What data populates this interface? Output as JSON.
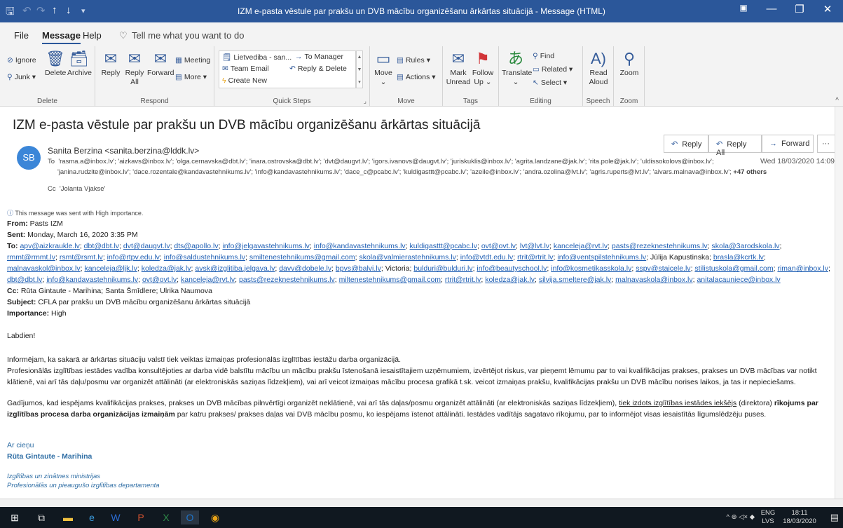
{
  "window": {
    "title": "IZM e-pasta vēstule par prakšu un DVB mācību organizēšanu ārkārtas situācijā  -  Message (HTML)"
  },
  "menu": {
    "file": "File",
    "message": "Message",
    "help": "Help",
    "tell_me": "Tell me what you want to do"
  },
  "ribbon": {
    "delete_group": {
      "label": "Delete",
      "ignore": "Ignore",
      "junk": "Junk",
      "delete": "Delete",
      "archive": "Archive"
    },
    "respond_group": {
      "label": "Respond",
      "reply": "Reply",
      "reply_all_1": "Reply",
      "reply_all_2": "All",
      "forward": "Forward",
      "meeting": "Meeting",
      "more": "More"
    },
    "quick_steps_group": {
      "label": "Quick Steps",
      "item1": "Lietvediba - san...",
      "item2": "To Manager",
      "item3": "Team Email",
      "item4": "Reply & Delete",
      "item5": "Create New"
    },
    "move_group": {
      "label": "Move",
      "move": "Move",
      "rules": "Rules",
      "actions": "Actions"
    },
    "tags_group": {
      "label": "Tags",
      "mark_unread_1": "Mark",
      "mark_unread_2": "Unread",
      "follow_up_1": "Follow",
      "follow_up_2": "Up"
    },
    "editing_group": {
      "label": "Editing",
      "translate": "Translate",
      "find": "Find",
      "related": "Related",
      "select": "Select"
    },
    "speech_group": {
      "label": "Speech",
      "read_aloud_1": "Read",
      "read_aloud_2": "Aloud"
    },
    "zoom_group": {
      "label": "Zoom",
      "zoom": "Zoom"
    }
  },
  "message": {
    "subject": "IZM e-pasta vēstule par prakšu un DVB mācību organizēšanu ārkārtas situācijā",
    "avatar_initials": "SB",
    "sender": "Sanita Berzina <sanita.berzina@lddk.lv>",
    "to_label": "To",
    "to_line1": "'rasma.a@inbox.lv'; 'aizkavs@inbox.lv'; 'olga.cernavska@dbt.lv'; 'inara.ostrovska@dbt.lv'; 'dvt@daugvt.lv'; 'igors.ivanovs@daugvt.lv'; 'juriskuklis@inbox.lv'; 'agrita.landzane@jak.lv'; 'rita.pole@jak.lv'; 'uldissokolovs@inbox.lv';",
    "to_line2": "'janina.rudzite@inbox.lv'; 'dace.rozentale@kandavastehnikums.lv'; 'info@kandavastehnikums.lv'; 'dace_c@pcabc.lv'; 'kuldigasttt@pcabc.lv'; 'azeile@inbox.lv'; 'andra.ozolina@lvt.lv'; 'agris.ruperts@lvt.lv'; 'aivars.malnava@inbox.lv';",
    "to_more": "+47 others",
    "cc_label": "Cc",
    "cc_value": "'Jolanta Vjakse'",
    "date": "Wed 18/03/2020 14:09",
    "importance_note": "This message was sent with High importance.",
    "actions": {
      "reply": "Reply",
      "reply_all": "Reply All",
      "forward": "Forward",
      "more": "···"
    }
  },
  "body": {
    "from_label": "From:",
    "from_value": "Pasts IZM",
    "sent_label": "Sent:",
    "sent_value": "Monday, March 16, 2020 3:35 PM",
    "to_label": "To:",
    "to_emails": [
      "apv@aizkraukle.lv",
      "dbt@dbt.lv",
      "dvt@daugvt.lv",
      "dts@apollo.lv",
      "info@jelgavastehnikums.lv",
      "info@kandavastehnikums.lv",
      "kuldigasttt@pcabc.lv",
      "ovt@ovt.lv",
      "lvt@lvt.lv",
      "kanceleja@rvt.lv",
      "pasts@rezeknestehnikums.lv",
      "skola@3arodskola.lv",
      "rmmt@rmmt.lv",
      "rsmt@rsmt.lv",
      "info@rtpv.edu.lv",
      "info@saldustehnikums.lv",
      "smiltenestehnikums@gmail.com",
      "skola@valmierastehnikums.lv",
      "info@vtdt.edu.lv",
      "rtrit@rtrit.lv",
      "info@ventspilstehnikums.lv",
      "Jūlija Kapustinska",
      "brasla@kcrtk.lv",
      "malnavaskol@inbox.lv",
      "kanceleja@ljk.lv",
      "koledza@jak.lv",
      "avsk@izglitiba.jelgava.lv",
      "davv@dobele.lv",
      "bpvs@balvi.lv",
      "Victoria",
      "bulduri@bulduri.lv",
      "info@beautyschool.lv",
      "info@kosmetikasskola.lv",
      "sspv@staicele.lv",
      "stilistuskola@gmail.com",
      "riman@inbox.lv",
      "dbt@dbt.lv",
      "info@kandavastehnikums.lv",
      "ovt@ovt.lv",
      "kanceleja@rvt.lv",
      "pasts@rezeknestehnikums.lv",
      "miltenestehnikums@gmail.com",
      "rtrit@rtrit.lv",
      "koledza@jak.lv",
      "silvija.smeltere@jak.lv",
      "malnavaskola@inbox.lv",
      "anitalacauniece@inbox.lv"
    ],
    "cc_label": "Cc:",
    "cc_value": "Rūta Gintaute - Marihina; Santa Šmīdlere; Ulrika Naumova",
    "subject_label": "Subject:",
    "subject_value": "CFLA par prakšu un DVB mācību organizēšanu ārkārtas situācijā",
    "importance_label": "Importance:",
    "importance_value": "High",
    "greeting": "Labdien!",
    "para1": "Informējam, ka sakarā ar ārkārtas situāciju valstī tiek veiktas izmaiņas profesionālās izglītības iestāžu darba organizācijā.",
    "para2": "Profesionālās izglītības iestādes vadība konsultējoties ar darba vidē balstītu mācību un mācību prakšu īstenošanā iesaistītajiem uzņēmumiem, izvērtējot riskus, var pieņemt lēmumu par to vai kvalifikācijas prakses, prakses un DVB mācības var notikt klātienē, vai arī tās daļu/posmu var organizēt attālināti (ar elektroniskās saziņas līdzekļiem), vai arī veicot izmaiņas mācību procesa grafikā t.sk. veicot izmaiņas prakšu, kvalifikācijas prakšu un DVB mācību norises laikos, ja tas ir nepieciešams.",
    "para3_a": "Gadījumos, kad iespējams kvalifikācijas prakses, prakses un DVB mācības pilnvērtīgi organizēt neklātienē, vai arī tās daļas/posmu organizēt attālināti (ar elektroniskās saziņas līdzekļiem), ",
    "para3_u": "tiek izdots izglītības iestādes iekšējs",
    "para3_b": " (direktora) ",
    "para3_bold": "rīkojums par izglītības procesa darba organizācijas izmaiņām",
    "para3_c": " par katru prakses/ prakses daļas vai DVB mācību posmu, ko iespējams īstenot attālināti. Iestādes vadītājs sagatavo rīkojumu, par to informējot visas iesaistītās līgumslēdzēju puses.",
    "signoff": "Ar cieņu",
    "signature_name": "Rūta Gintaute - Marihina",
    "sig_line1": "Izglītības un zinātnes ministrijas",
    "sig_line2": "Profesionālās un pieaugušo izglītības departamenta"
  },
  "taskbar": {
    "lang_1": "ENG",
    "lang_2": "LVS",
    "time": "18:11",
    "date": "18/03/2020"
  }
}
